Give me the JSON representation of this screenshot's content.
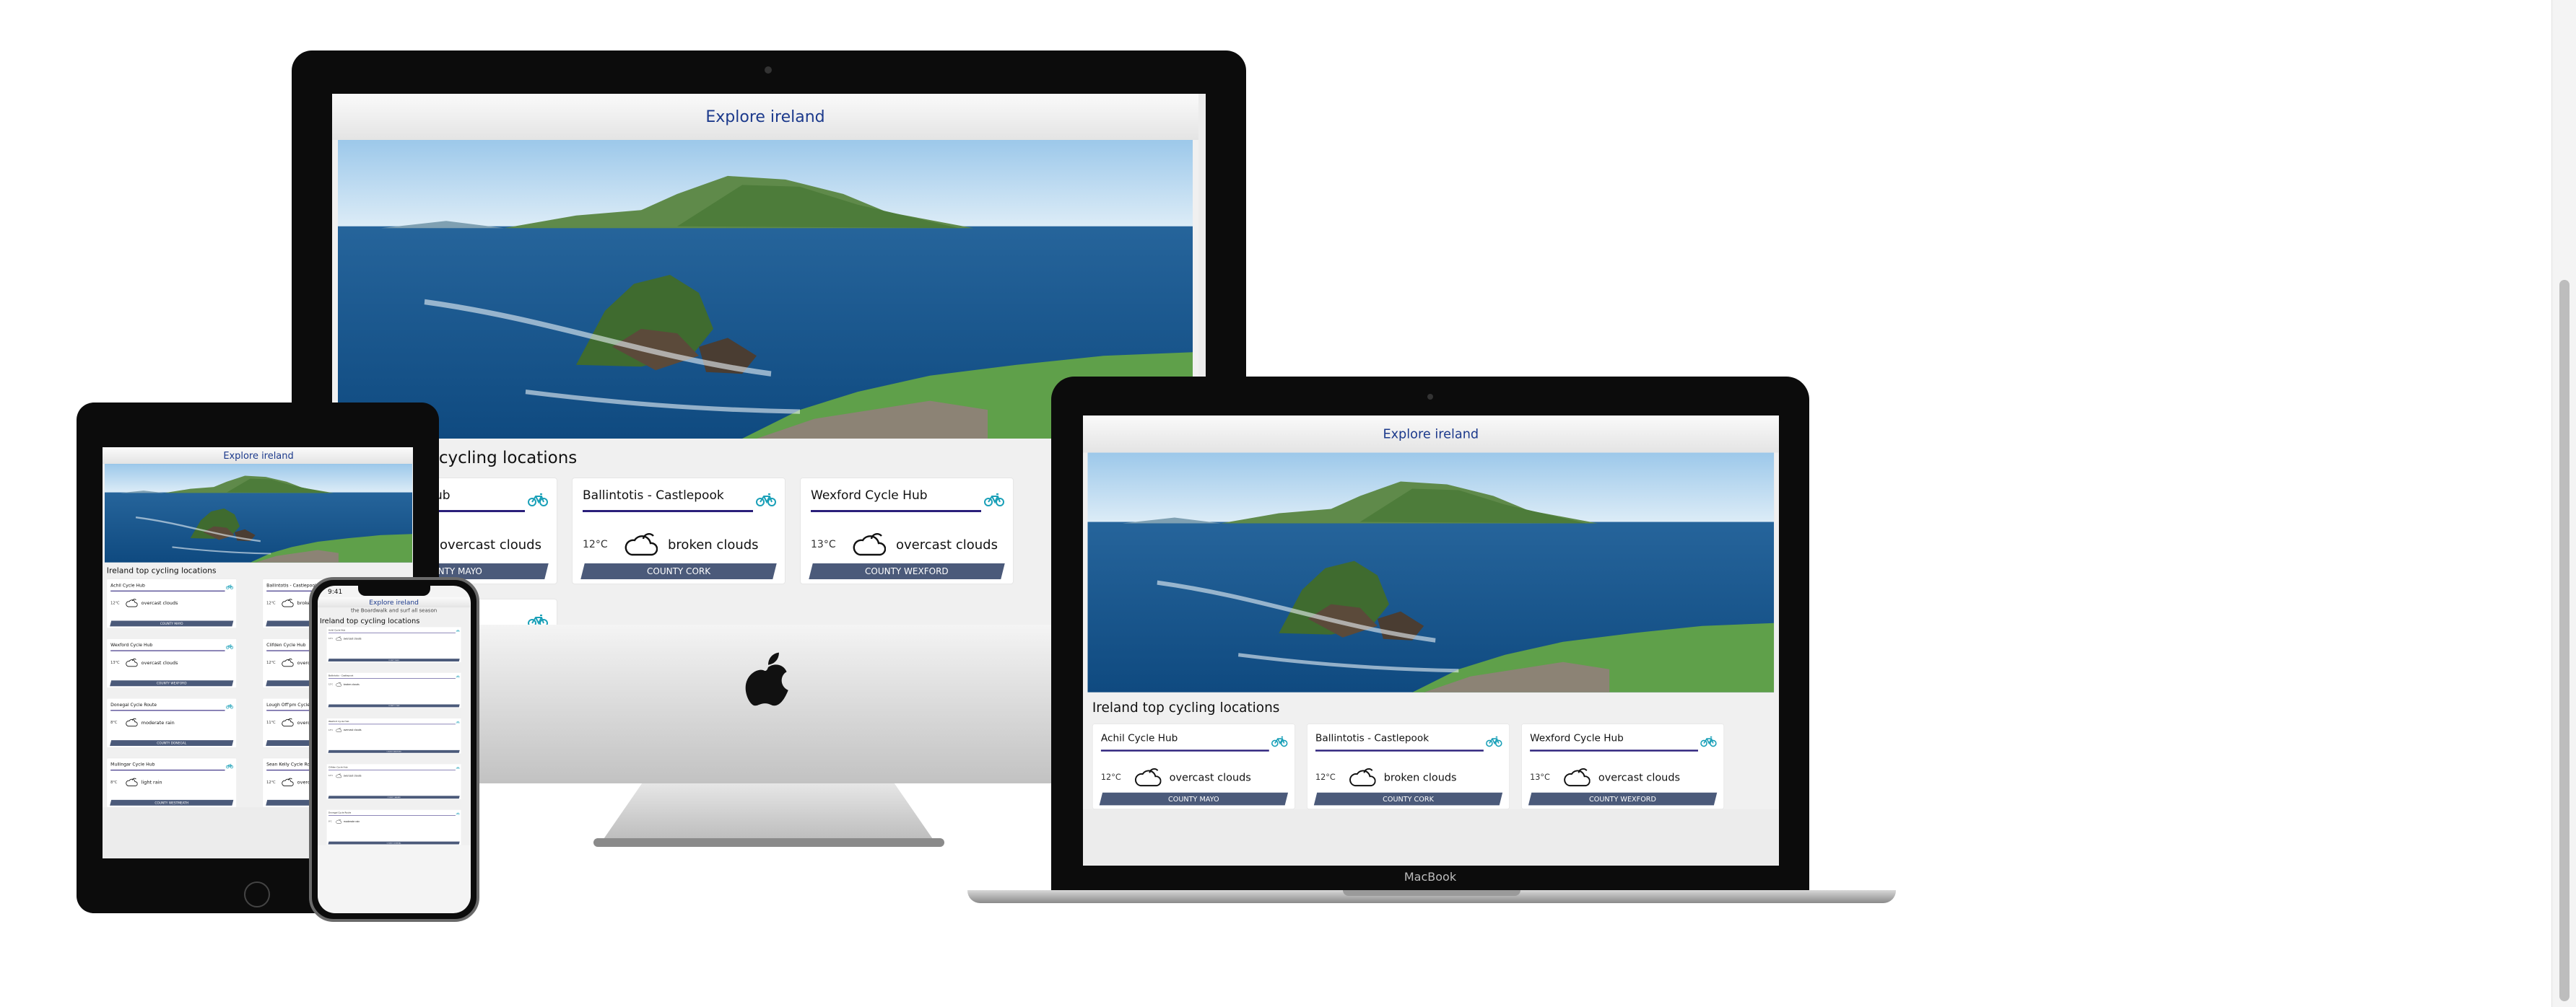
{
  "site": {
    "title": "Explore ireland",
    "tagline": "the Boardwalk and surf all season",
    "section_title": "Ireland top cycling locations",
    "temp_unit": "°C"
  },
  "locations": [
    {
      "name": "Achil Cycle Hub",
      "temp": "12°C",
      "condition": "overcast clouds",
      "county": "COUNTY MAYO"
    },
    {
      "name": "Ballintotis - Castlepook",
      "temp": "12°C",
      "condition": "broken clouds",
      "county": "COUNTY CORK"
    },
    {
      "name": "Wexford Cycle Hub",
      "temp": "13°C",
      "condition": "overcast clouds",
      "county": "COUNTY WEXFORD"
    },
    {
      "name": "Clifden Cycle Hub",
      "temp": "12°C",
      "condition": "overcast clouds",
      "county": "COUNTY GALWAY"
    },
    {
      "name": "Donegal Cycle Route",
      "temp": "8°C",
      "condition": "moderate rain",
      "county": "COUNTY DONEGAL"
    },
    {
      "name": "Lough Off'pm Cycle Route",
      "temp": "11°C",
      "condition": "overcast clouds",
      "county": "COUNTY OFFALY"
    },
    {
      "name": "Mullingar Cycle Hub",
      "temp": "8°C",
      "condition": "light rain",
      "county": "COUNTY WESTMEATH"
    },
    {
      "name": "Sean Kelly Cycle Route",
      "temp": "12°C",
      "condition": "overcast clouds",
      "county": "COUNTY WATERFORD"
    }
  ],
  "devices": {
    "laptop_brand": "MacBook",
    "phone_status_time": "9:41"
  },
  "colors": {
    "title_blue": "#1c3a8c",
    "rule_purple": "#2a1f7a",
    "county_bar": "#4b5a7a",
    "bike_teal": "#1aa0b8"
  }
}
